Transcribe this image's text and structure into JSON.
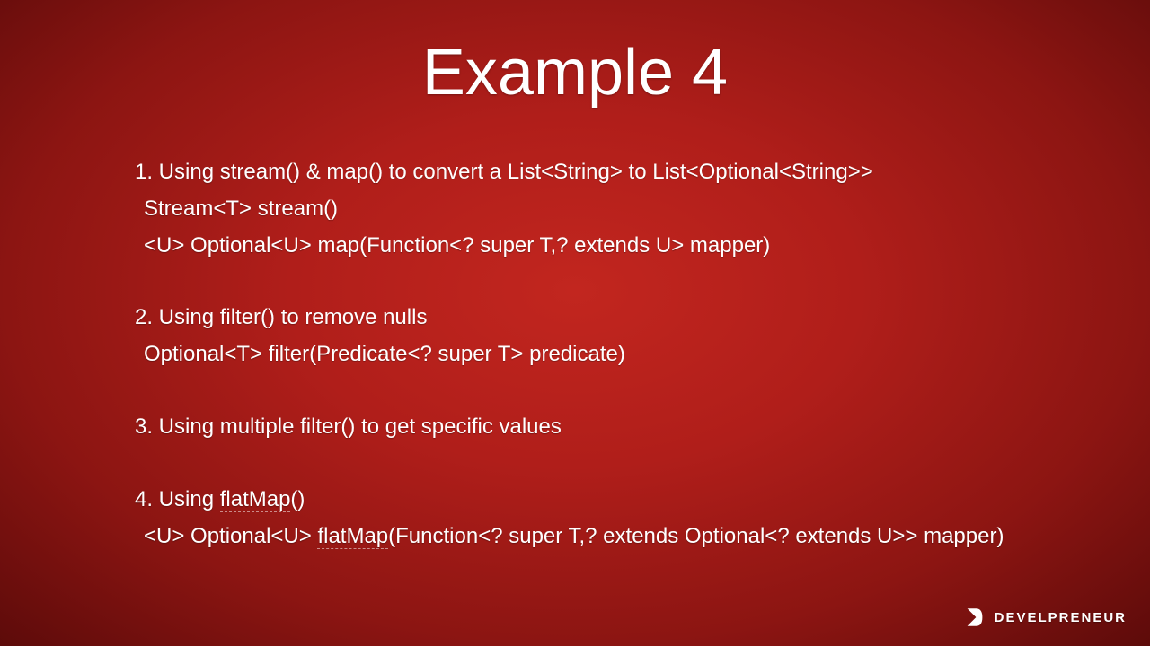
{
  "title": "Example 4",
  "sections": [
    {
      "head": "1. Using stream() & map() to convert a List<String> to List<Optional<String>>",
      "subs": [
        "Stream<T> stream()",
        "<U> Optional<U> map(Function<? super T,? extends U> mapper)"
      ]
    },
    {
      "head": "2. Using filter() to remove nulls",
      "subs": [
        "Optional<T> filter(Predicate<? super T> predicate)"
      ]
    },
    {
      "head": "3. Using multiple filter() to get specific values",
      "subs": []
    },
    {
      "head_parts": [
        "4. Using ",
        "flatMap",
        "()"
      ],
      "sub_parts": [
        [
          "<U> Optional<U> ",
          "flatMap",
          "(Function<? super T,? extends Optional<? extends U>> mapper)"
        ]
      ]
    }
  ],
  "logo": {
    "text": "DEVELPRENEUR"
  }
}
